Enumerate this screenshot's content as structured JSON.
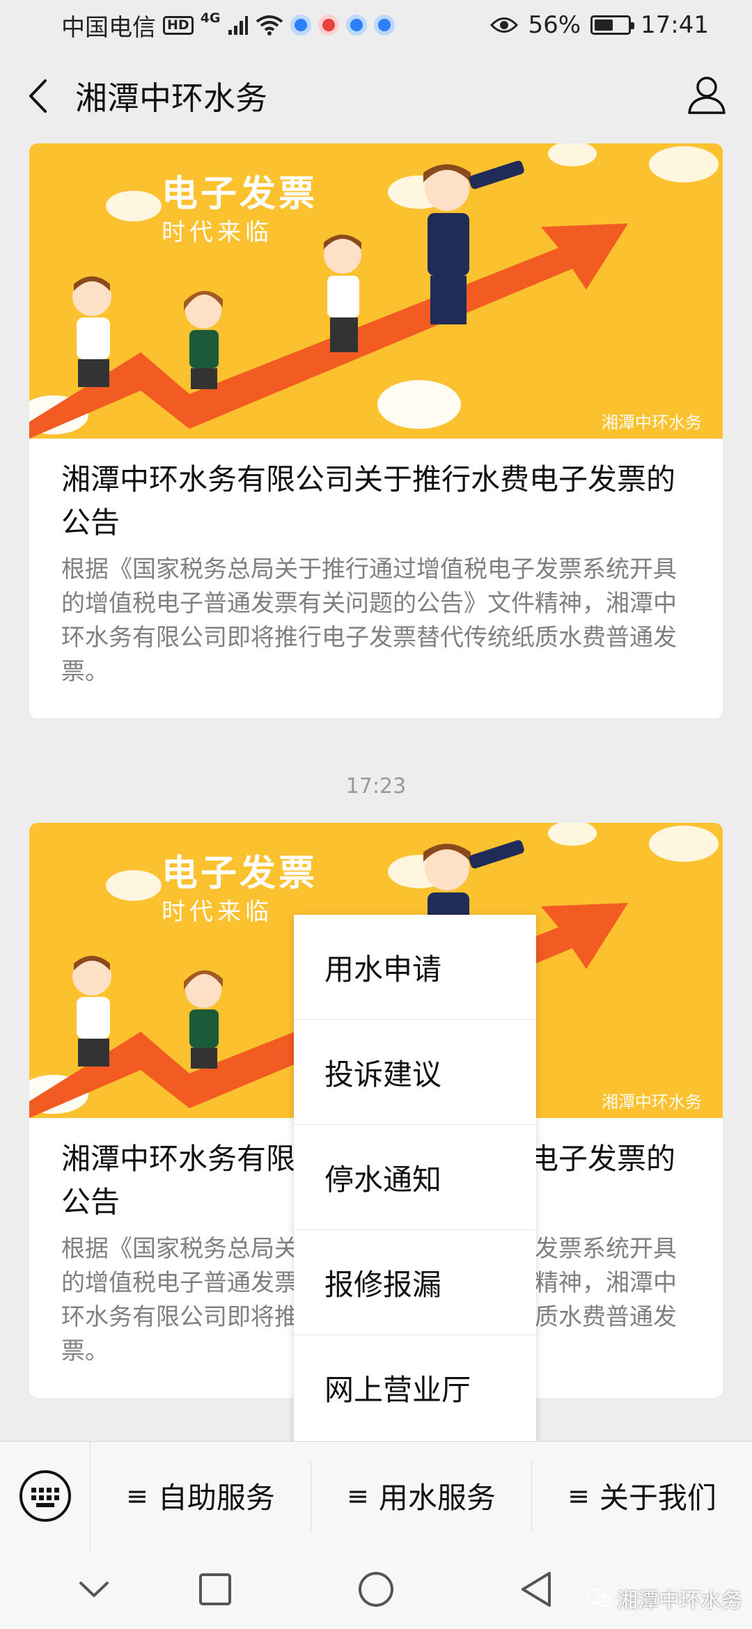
{
  "status_bar": {
    "carrier": "中国电信",
    "hd": "HD",
    "network": "4G",
    "battery_percent": "56%",
    "battery_level": 0.56,
    "time": "17:41"
  },
  "title_bar": {
    "title": "湘潭中环水务"
  },
  "articles": [
    {
      "banner_heading": "电子发票",
      "banner_sub": "时代来临",
      "banner_watermark": "湘潭中环水务",
      "title": "湘潭中环水务有限公司关于推行水费电子发票的公告",
      "summary": "根据《国家税务总局关于推行通过增值税电子发票系统开具的增值税电子普通发票有关问题的公告》文件精神，湘潭中环水务有限公司即将推行电子发票替代传统纸质水费普通发票。"
    },
    {
      "banner_heading": "电子发票",
      "banner_sub": "时代来临",
      "banner_watermark": "湘潭中环水务",
      "title": "湘潭中环水务有限公司关于推行水费电子发票的公告",
      "summary": "根据《国家税务总局关于推行通过增值税电子发票系统开具的增值税电子普通发票有关问题的公告》文件精神，湘潭中环水务有限公司即将推行电子发票替代传统纸质水费普通发票。"
    }
  ],
  "timestamp": "17:23",
  "popup_menu": {
    "items": [
      "用水申请",
      "投诉建议",
      "停水通知",
      "报修报漏",
      "网上营业厅"
    ]
  },
  "bottom_menu": {
    "items": [
      "自助服务",
      "用水服务",
      "关于我们"
    ],
    "menu_symbol": "≡"
  },
  "watermark": "湘潭中环水务",
  "colors": {
    "banner_bg": "#fcc12f",
    "arrow": "#f25b22",
    "background": "#ededed"
  }
}
